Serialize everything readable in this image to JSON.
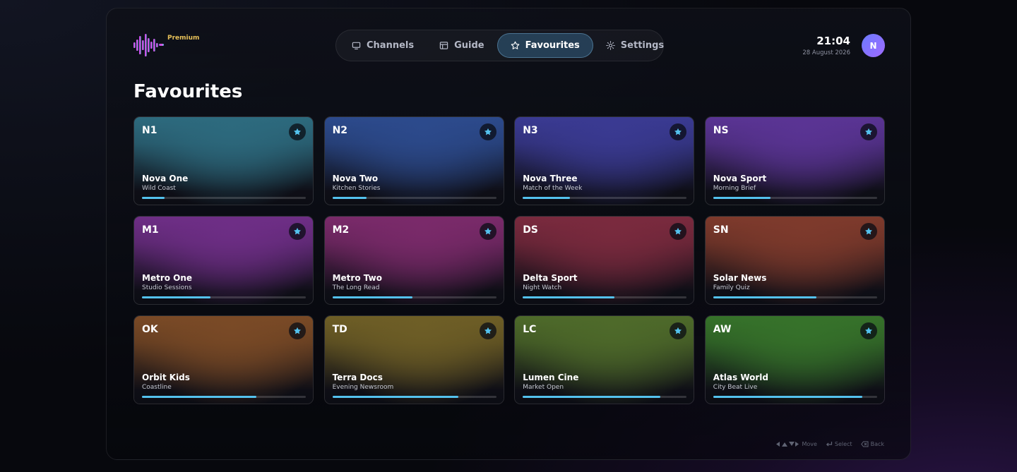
{
  "header": {
    "badge": "Premium",
    "nav": [
      {
        "label": "Channels",
        "icon": "tv-icon",
        "active": false
      },
      {
        "label": "Guide",
        "icon": "guide-icon",
        "active": false
      },
      {
        "label": "Favourites",
        "icon": "star-icon",
        "active": true
      },
      {
        "label": "Settings",
        "icon": "settings-icon",
        "active": false
      }
    ],
    "time": "21:04",
    "date": "28 August 2026",
    "avatar_initial": "N"
  },
  "page_title": "Favourites",
  "accent_color": "#54c2ee",
  "channels": [
    {
      "code": "N1",
      "name": "Nova One",
      "program": "Wild Coast",
      "progress": 0.14,
      "color": "#2d6a7e"
    },
    {
      "code": "N2",
      "name": "Nova Two",
      "program": "Kitchen Stories",
      "progress": 0.21,
      "color": "#2c4a8c"
    },
    {
      "code": "N3",
      "name": "Nova Three",
      "program": "Match of the Week",
      "progress": 0.29,
      "color": "#3a3a92"
    },
    {
      "code": "NS",
      "name": "Nova Sport",
      "program": "Morning Brief",
      "progress": 0.35,
      "color": "#5a3494"
    },
    {
      "code": "M1",
      "name": "Metro One",
      "program": "Studio Sessions",
      "progress": 0.42,
      "color": "#6e2e86"
    },
    {
      "code": "M2",
      "name": "Metro Two",
      "program": "The Long Read",
      "progress": 0.49,
      "color": "#7a2a6a"
    },
    {
      "code": "DS",
      "name": "Delta Sport",
      "program": "Night Watch",
      "progress": 0.56,
      "color": "#7a2a3e"
    },
    {
      "code": "SN",
      "name": "Solar News",
      "program": "Family Quiz",
      "progress": 0.63,
      "color": "#7e3a2c"
    },
    {
      "code": "OK",
      "name": "Orbit Kids",
      "program": "Coastline",
      "progress": 0.7,
      "color": "#7a4a26"
    },
    {
      "code": "TD",
      "name": "Terra Docs",
      "program": "Evening Newsroom",
      "progress": 0.77,
      "color": "#6e5e26"
    },
    {
      "code": "LC",
      "name": "Lumen Cine",
      "program": "Market Open",
      "progress": 0.84,
      "color": "#4e6a2a"
    },
    {
      "code": "AW",
      "name": "Atlas World",
      "program": "City Beat Live",
      "progress": 0.91,
      "color": "#36722a"
    }
  ],
  "hints": [
    {
      "icon": "arrows-icon",
      "label": "Move"
    },
    {
      "icon": "enter-icon",
      "label": "Select"
    },
    {
      "icon": "backspace-icon",
      "label": "Back"
    }
  ]
}
